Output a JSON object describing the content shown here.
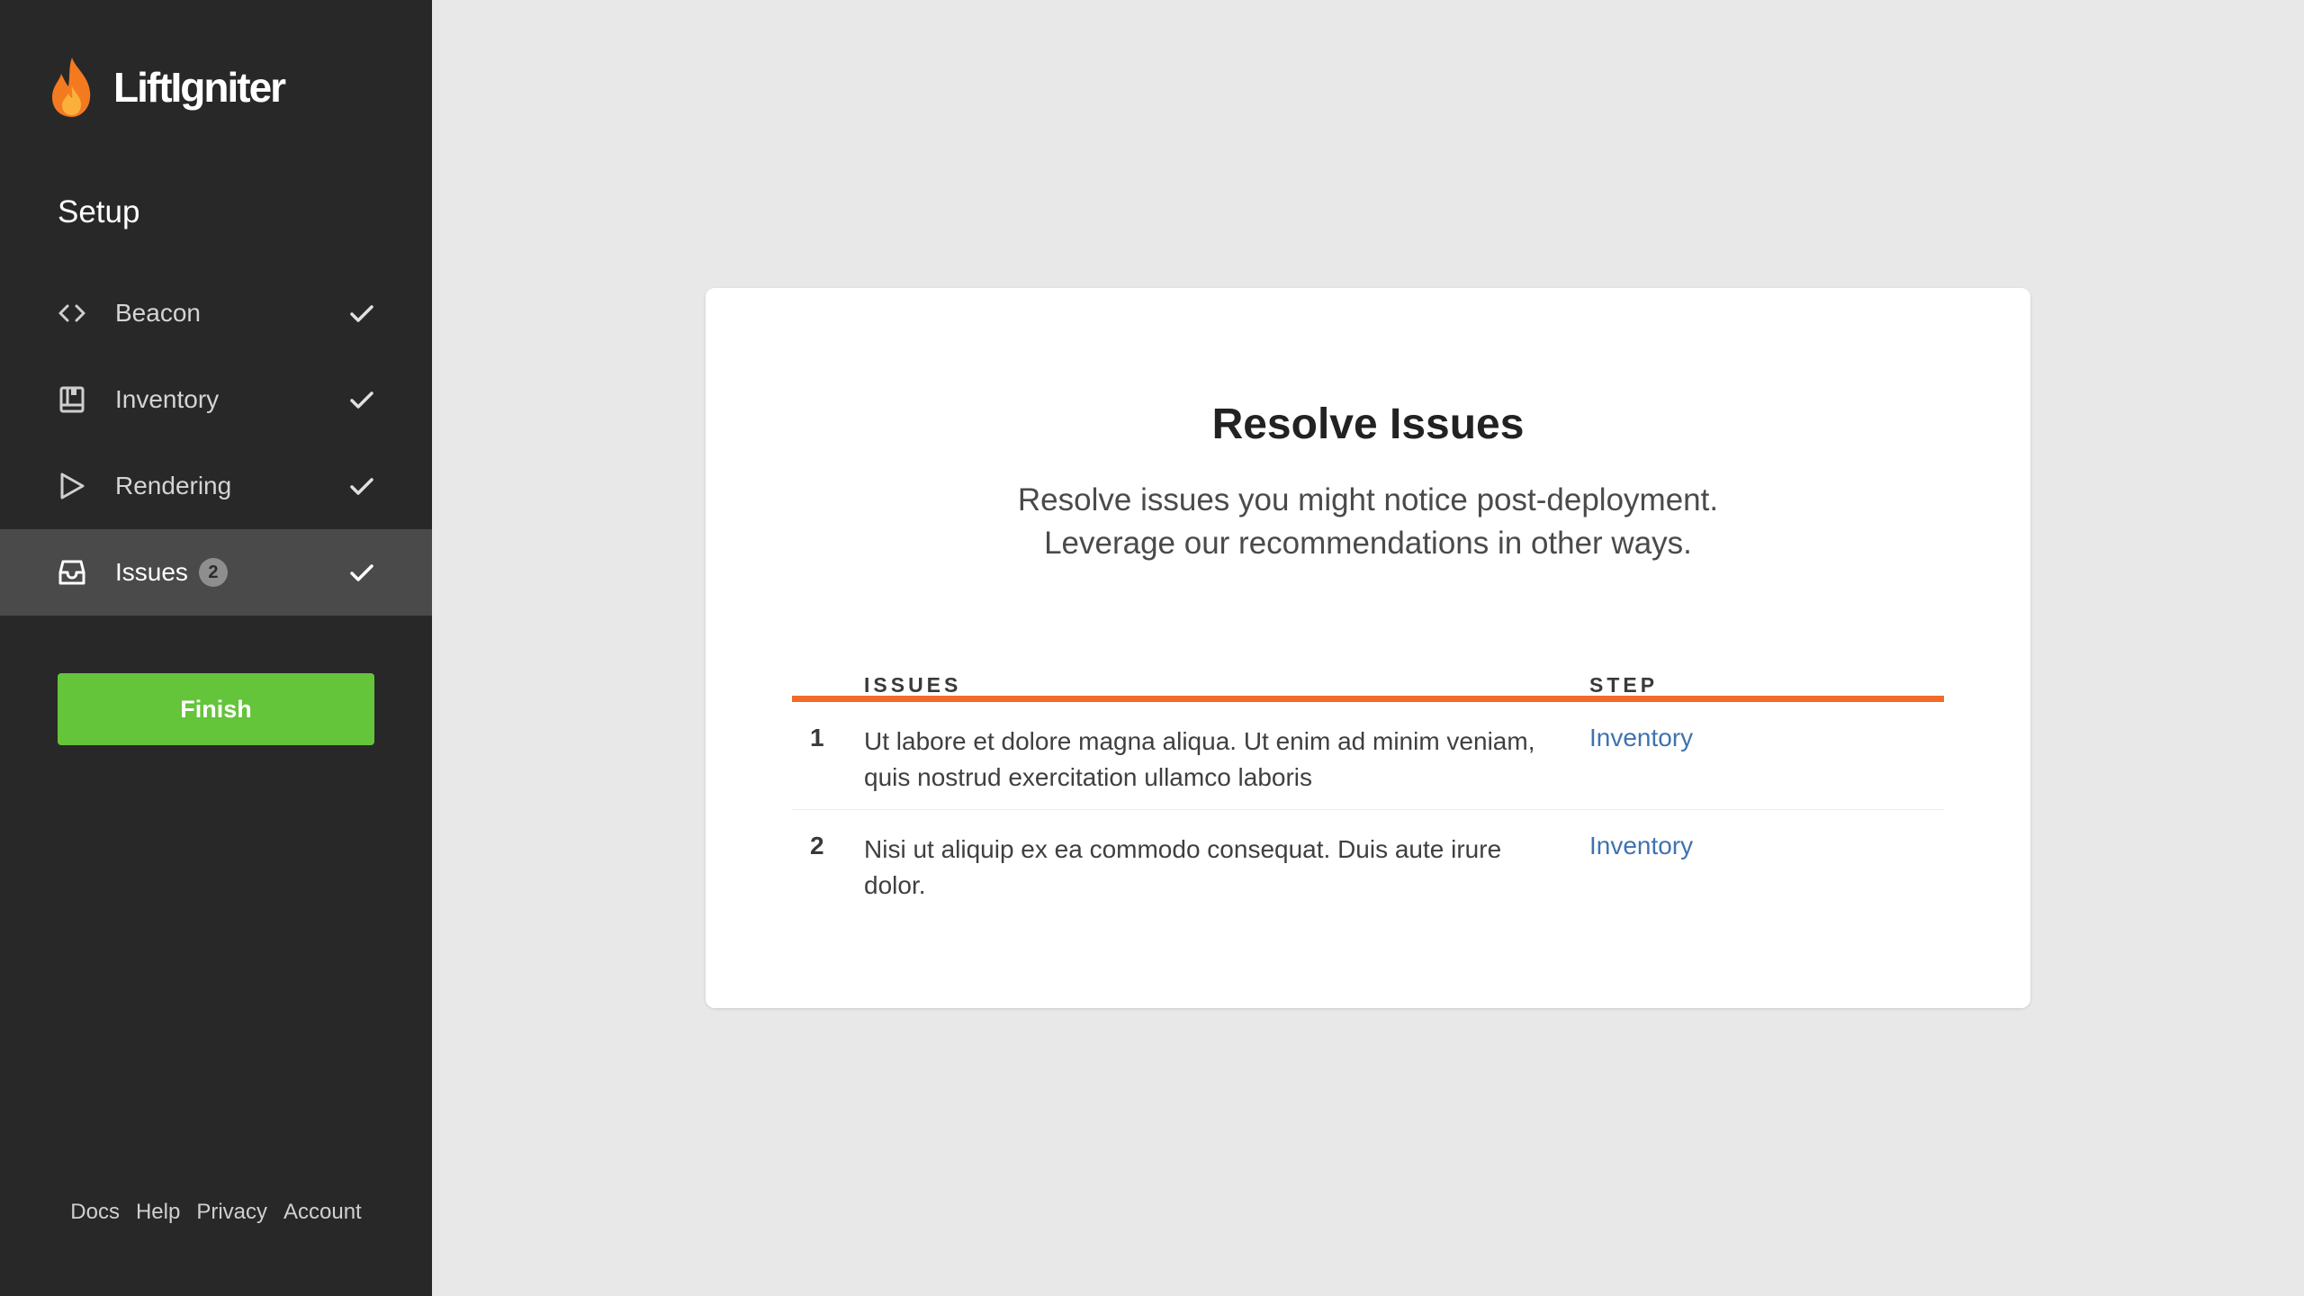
{
  "brand": {
    "name": "LiftIgniter",
    "logo_icon": "flame-icon"
  },
  "sidebar": {
    "section_title": "Setup",
    "items": [
      {
        "label": "Beacon",
        "icon": "code-icon",
        "completed": true,
        "active": false
      },
      {
        "label": "Inventory",
        "icon": "book-icon",
        "completed": true,
        "active": false
      },
      {
        "label": "Rendering",
        "icon": "play-icon",
        "completed": true,
        "active": false
      },
      {
        "label": "Issues",
        "icon": "inbox-icon",
        "badge": "2",
        "completed": true,
        "active": true
      }
    ],
    "finish_label": "Finish",
    "footer_links": [
      "Docs",
      "Help",
      "Privacy",
      "Account"
    ]
  },
  "main": {
    "title": "Resolve Issues",
    "subtitle_line1": "Resolve issues you might notice post-deployment.",
    "subtitle_line2": "Leverage our recommendations in other ways.",
    "table": {
      "headers": {
        "issues": "ISSUES",
        "step": "STEP"
      },
      "rows": [
        {
          "num": "1",
          "text": "Ut labore et dolore magna aliqua. Ut enim ad minim veniam, quis nostrud exercitation ullamco laboris",
          "step": "Inventory"
        },
        {
          "num": "2",
          "text": "Nisi ut aliquip ex ea commodo consequat. Duis aute irure dolor.",
          "step": "Inventory"
        }
      ]
    }
  },
  "colors": {
    "sidebar_bg": "#282828",
    "active_bg": "#4a4a4a",
    "finish_green": "#64c43a",
    "accent_orange": "#f26b2a",
    "link_blue": "#3f72b0",
    "page_bg": "#e8e8e8"
  }
}
